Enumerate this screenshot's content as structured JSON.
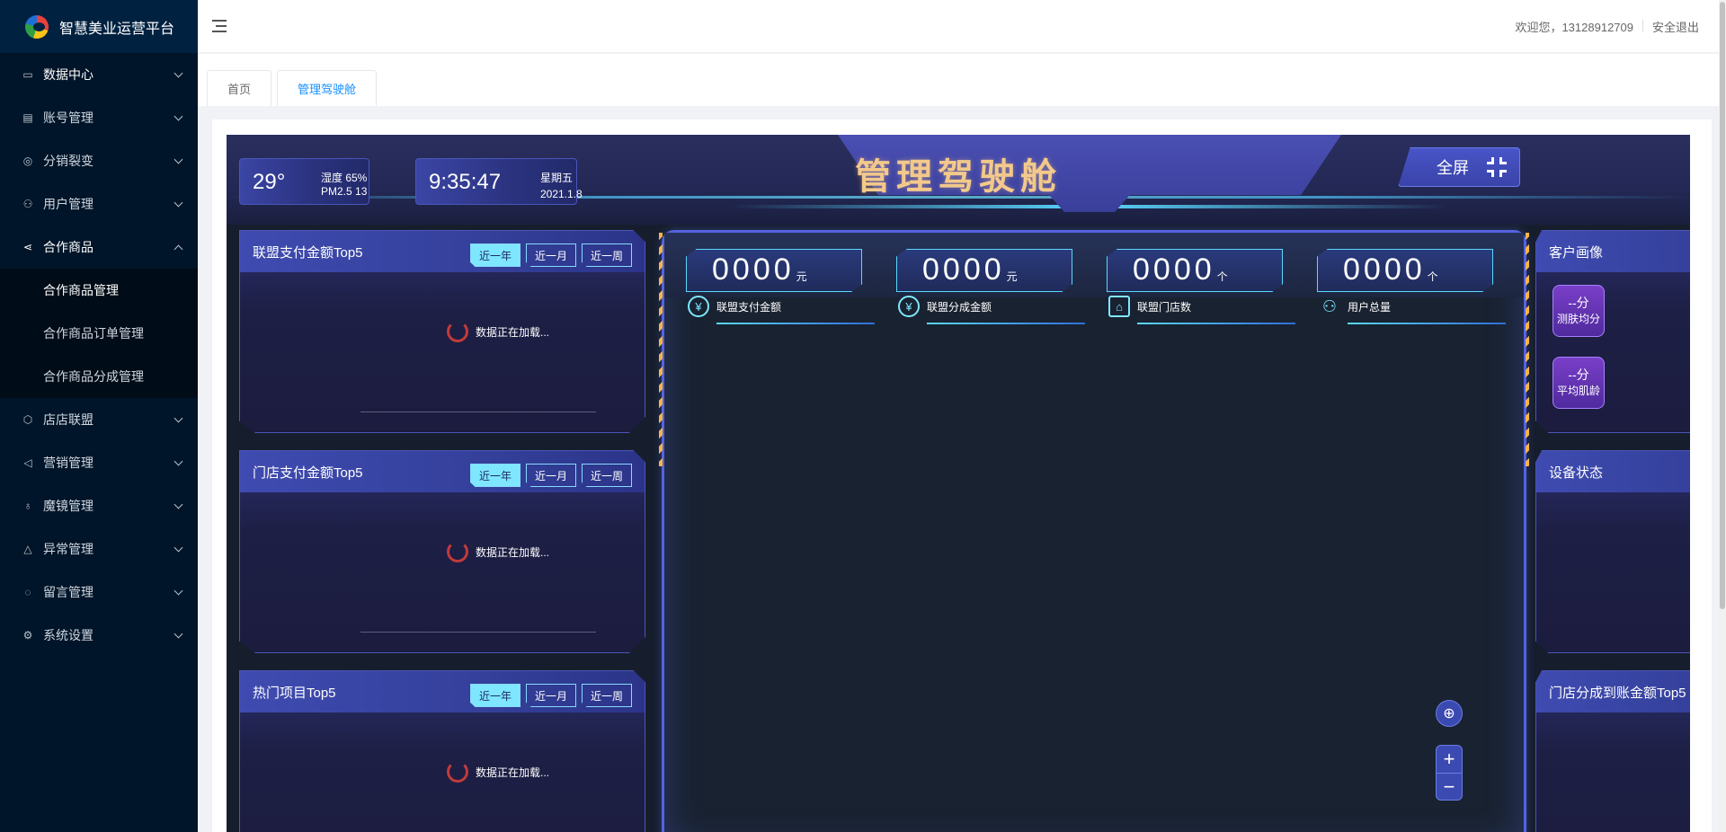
{
  "app": {
    "title": "智慧美业运营平台"
  },
  "sidebar": {
    "items": [
      {
        "label": "数据中心",
        "icon": "monitor-icon"
      },
      {
        "label": "账号管理",
        "icon": "id-card-icon"
      },
      {
        "label": "分销裂变",
        "icon": "share-circle-icon"
      },
      {
        "label": "用户管理",
        "icon": "user-icon"
      },
      {
        "label": "合作商品",
        "icon": "share-icon"
      },
      {
        "label": "店店联盟",
        "icon": "cube-icon"
      },
      {
        "label": "营销管理",
        "icon": "megaphone-icon"
      },
      {
        "label": "魔镜管理",
        "icon": "bulb-icon"
      },
      {
        "label": "异常管理",
        "icon": "warning-icon"
      },
      {
        "label": "留言管理",
        "icon": "message-icon"
      },
      {
        "label": "系统设置",
        "icon": "gear-icon"
      }
    ],
    "submenu": [
      "合作商品管理",
      "合作商品订单管理",
      "合作商品分成管理"
    ]
  },
  "header": {
    "welcome": "欢迎您，13128912709",
    "logout": "安全退出"
  },
  "tabs": [
    {
      "label": "首页"
    },
    {
      "label": "管理驾驶舱"
    }
  ],
  "cockpit": {
    "title": "管理驾驶舱",
    "fullscreen": "全屏",
    "weather": {
      "temp": "29°",
      "humidity": "湿度 65%",
      "pm": "PM2.5 13"
    },
    "clock": {
      "time": "9:35:47",
      "weekday": "星期五",
      "date": "2021.1.8"
    },
    "range_options": [
      "近一年",
      "近一月",
      "近一周"
    ],
    "loading_text": "数据正在加载...",
    "left_panels": [
      {
        "title": "联盟支付金额Top5"
      },
      {
        "title": "门店支付金额Top5"
      },
      {
        "title": "热门项目Top5"
      }
    ],
    "stats": [
      {
        "value": "0000",
        "unit": "元",
        "label": "联盟支付金额",
        "icon": "yen-icon"
      },
      {
        "value": "0000",
        "unit": "元",
        "label": "联盟分成金额",
        "icon": "yen-icon"
      },
      {
        "value": "0000",
        "unit": "个",
        "label": "联盟门店数",
        "icon": "store-icon"
      },
      {
        "value": "0000",
        "unit": "个",
        "label": "用户总量",
        "icon": "users-icon"
      }
    ],
    "right_panels": [
      {
        "title": "客户画像"
      },
      {
        "title": "设备状态"
      },
      {
        "title": "门店分成到账金额Top5"
      }
    ],
    "portrait": [
      {
        "value": "--分",
        "label": "测肤均分"
      },
      {
        "value": "--分",
        "label": "平均肌龄"
      }
    ],
    "map_controls": {
      "zoom_in": "+",
      "zoom_out": "−"
    }
  }
}
